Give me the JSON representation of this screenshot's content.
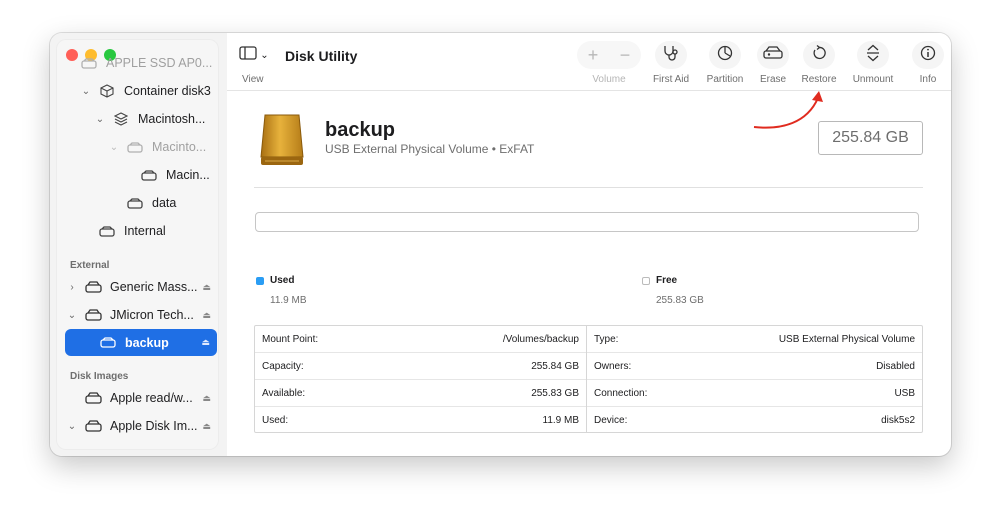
{
  "window": {
    "title": "Disk Utility"
  },
  "toolbar": {
    "view_label": "View",
    "buttons": [
      {
        "label": "Volume",
        "enabled": false
      },
      {
        "label": "First Aid",
        "enabled": true
      },
      {
        "label": "Partition",
        "enabled": true
      },
      {
        "label": "Erase",
        "enabled": true
      },
      {
        "label": "Restore",
        "enabled": true
      },
      {
        "label": "Unmount",
        "enabled": true
      },
      {
        "label": "Info",
        "enabled": true
      }
    ]
  },
  "sidebar": {
    "items": [
      {
        "label": "APPLE SSD AP0..."
      },
      {
        "label": "Container disk3"
      },
      {
        "label": "Macintosh..."
      },
      {
        "label": "Macinto..."
      },
      {
        "label": "Macin..."
      },
      {
        "label": "data"
      },
      {
        "label": "Internal"
      }
    ],
    "section_external": "External",
    "external_items": [
      {
        "label": "Generic Mass..."
      },
      {
        "label": "JMicron Tech..."
      },
      {
        "label": "backup"
      }
    ],
    "section_disk_images": "Disk Images",
    "image_items": [
      {
        "label": "Apple read/w..."
      },
      {
        "label": "Apple Disk Im..."
      }
    ]
  },
  "volume": {
    "name": "backup",
    "subtitle": "USB External Physical Volume • ExFAT",
    "capacity_display": "255.84 GB"
  },
  "usage": {
    "used_label": "Used",
    "used_value": "11.9 MB",
    "free_label": "Free",
    "free_value": "255.83 GB",
    "used_fraction": 0.0001,
    "used_color": "#2a9df4"
  },
  "info": {
    "left": [
      {
        "key": "Mount Point:",
        "value": "/Volumes/backup"
      },
      {
        "key": "Capacity:",
        "value": "255.84 GB"
      },
      {
        "key": "Available:",
        "value": "255.83 GB"
      },
      {
        "key": "Used:",
        "value": "11.9 MB"
      }
    ],
    "right": [
      {
        "key": "Type:",
        "value": "USB External Physical Volume"
      },
      {
        "key": "Owners:",
        "value": "Disabled"
      },
      {
        "key": "Connection:",
        "value": "USB"
      },
      {
        "key": "Device:",
        "value": "disk5s2"
      }
    ]
  },
  "annotation": {
    "arrow_color": "#e02b1f"
  }
}
